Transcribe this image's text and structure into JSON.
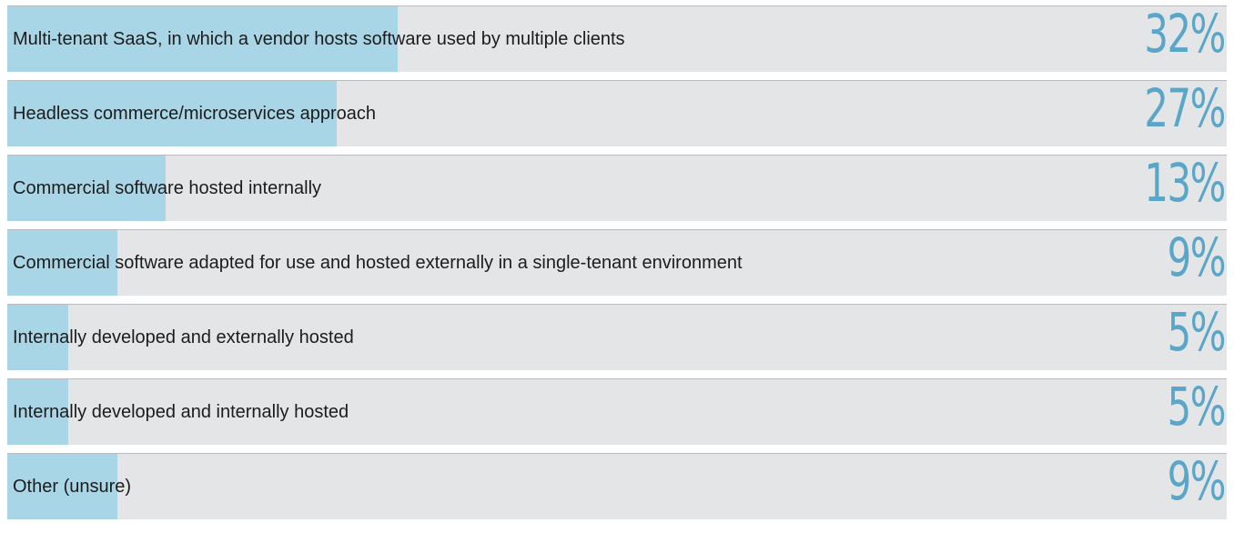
{
  "chart_data": {
    "type": "bar",
    "orientation": "horizontal",
    "categories": [
      "Multi-tenant SaaS, in which a vendor hosts software used by multiple clients",
      "Headless commerce/microservices approach",
      "Commercial software hosted internally",
      "Commercial software adapted for use and hosted externally in a single-tenant environment",
      "Internally developed and externally hosted",
      "Internally developed and internally hosted",
      "Other (unsure)"
    ],
    "values": [
      32,
      27,
      13,
      9,
      5,
      5,
      9
    ],
    "value_labels": [
      "32%",
      "27%",
      "13%",
      "9%",
      "5%",
      "5%",
      "9%"
    ],
    "unit": "%",
    "xlim": [
      0,
      100
    ],
    "grid": false,
    "legend": "none"
  },
  "colors": {
    "track": "#e4e5e7",
    "fill": "#a9d6e6",
    "value_text": "#5aa6c8",
    "label_text": "#1c1c1c",
    "divider": "#b9bbbe"
  }
}
